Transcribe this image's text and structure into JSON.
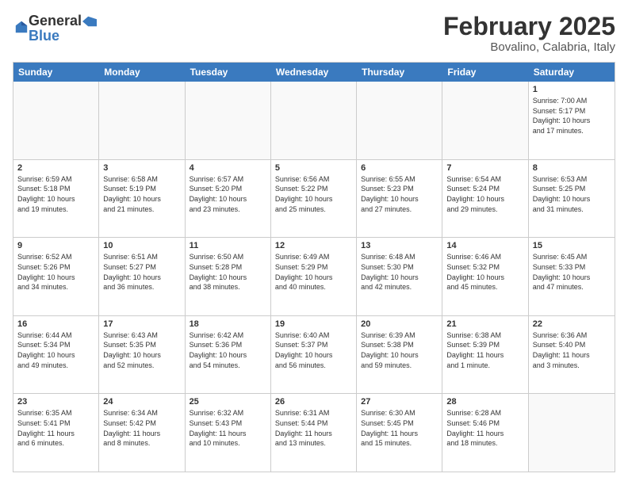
{
  "logo": {
    "general": "General",
    "blue": "Blue"
  },
  "header": {
    "month": "February 2025",
    "location": "Bovalino, Calabria, Italy"
  },
  "days": [
    "Sunday",
    "Monday",
    "Tuesday",
    "Wednesday",
    "Thursday",
    "Friday",
    "Saturday"
  ],
  "weeks": [
    [
      {
        "day": "",
        "info": ""
      },
      {
        "day": "",
        "info": ""
      },
      {
        "day": "",
        "info": ""
      },
      {
        "day": "",
        "info": ""
      },
      {
        "day": "",
        "info": ""
      },
      {
        "day": "",
        "info": ""
      },
      {
        "day": "1",
        "info": "Sunrise: 7:00 AM\nSunset: 5:17 PM\nDaylight: 10 hours\nand 17 minutes."
      }
    ],
    [
      {
        "day": "2",
        "info": "Sunrise: 6:59 AM\nSunset: 5:18 PM\nDaylight: 10 hours\nand 19 minutes."
      },
      {
        "day": "3",
        "info": "Sunrise: 6:58 AM\nSunset: 5:19 PM\nDaylight: 10 hours\nand 21 minutes."
      },
      {
        "day": "4",
        "info": "Sunrise: 6:57 AM\nSunset: 5:20 PM\nDaylight: 10 hours\nand 23 minutes."
      },
      {
        "day": "5",
        "info": "Sunrise: 6:56 AM\nSunset: 5:22 PM\nDaylight: 10 hours\nand 25 minutes."
      },
      {
        "day": "6",
        "info": "Sunrise: 6:55 AM\nSunset: 5:23 PM\nDaylight: 10 hours\nand 27 minutes."
      },
      {
        "day": "7",
        "info": "Sunrise: 6:54 AM\nSunset: 5:24 PM\nDaylight: 10 hours\nand 29 minutes."
      },
      {
        "day": "8",
        "info": "Sunrise: 6:53 AM\nSunset: 5:25 PM\nDaylight: 10 hours\nand 31 minutes."
      }
    ],
    [
      {
        "day": "9",
        "info": "Sunrise: 6:52 AM\nSunset: 5:26 PM\nDaylight: 10 hours\nand 34 minutes."
      },
      {
        "day": "10",
        "info": "Sunrise: 6:51 AM\nSunset: 5:27 PM\nDaylight: 10 hours\nand 36 minutes."
      },
      {
        "day": "11",
        "info": "Sunrise: 6:50 AM\nSunset: 5:28 PM\nDaylight: 10 hours\nand 38 minutes."
      },
      {
        "day": "12",
        "info": "Sunrise: 6:49 AM\nSunset: 5:29 PM\nDaylight: 10 hours\nand 40 minutes."
      },
      {
        "day": "13",
        "info": "Sunrise: 6:48 AM\nSunset: 5:30 PM\nDaylight: 10 hours\nand 42 minutes."
      },
      {
        "day": "14",
        "info": "Sunrise: 6:46 AM\nSunset: 5:32 PM\nDaylight: 10 hours\nand 45 minutes."
      },
      {
        "day": "15",
        "info": "Sunrise: 6:45 AM\nSunset: 5:33 PM\nDaylight: 10 hours\nand 47 minutes."
      }
    ],
    [
      {
        "day": "16",
        "info": "Sunrise: 6:44 AM\nSunset: 5:34 PM\nDaylight: 10 hours\nand 49 minutes."
      },
      {
        "day": "17",
        "info": "Sunrise: 6:43 AM\nSunset: 5:35 PM\nDaylight: 10 hours\nand 52 minutes."
      },
      {
        "day": "18",
        "info": "Sunrise: 6:42 AM\nSunset: 5:36 PM\nDaylight: 10 hours\nand 54 minutes."
      },
      {
        "day": "19",
        "info": "Sunrise: 6:40 AM\nSunset: 5:37 PM\nDaylight: 10 hours\nand 56 minutes."
      },
      {
        "day": "20",
        "info": "Sunrise: 6:39 AM\nSunset: 5:38 PM\nDaylight: 10 hours\nand 59 minutes."
      },
      {
        "day": "21",
        "info": "Sunrise: 6:38 AM\nSunset: 5:39 PM\nDaylight: 11 hours\nand 1 minute."
      },
      {
        "day": "22",
        "info": "Sunrise: 6:36 AM\nSunset: 5:40 PM\nDaylight: 11 hours\nand 3 minutes."
      }
    ],
    [
      {
        "day": "23",
        "info": "Sunrise: 6:35 AM\nSunset: 5:41 PM\nDaylight: 11 hours\nand 6 minutes."
      },
      {
        "day": "24",
        "info": "Sunrise: 6:34 AM\nSunset: 5:42 PM\nDaylight: 11 hours\nand 8 minutes."
      },
      {
        "day": "25",
        "info": "Sunrise: 6:32 AM\nSunset: 5:43 PM\nDaylight: 11 hours\nand 10 minutes."
      },
      {
        "day": "26",
        "info": "Sunrise: 6:31 AM\nSunset: 5:44 PM\nDaylight: 11 hours\nand 13 minutes."
      },
      {
        "day": "27",
        "info": "Sunrise: 6:30 AM\nSunset: 5:45 PM\nDaylight: 11 hours\nand 15 minutes."
      },
      {
        "day": "28",
        "info": "Sunrise: 6:28 AM\nSunset: 5:46 PM\nDaylight: 11 hours\nand 18 minutes."
      },
      {
        "day": "",
        "info": ""
      }
    ]
  ]
}
